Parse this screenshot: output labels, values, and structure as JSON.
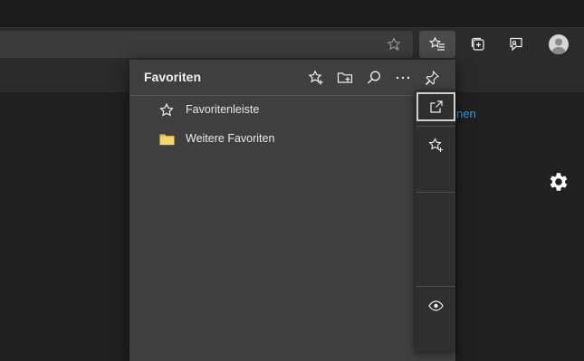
{
  "flyout": {
    "title": "Favoriten",
    "items": [
      {
        "label": "Favoritenleiste",
        "icon": "star-outline-icon"
      },
      {
        "label": "Weitere Favoriten",
        "icon": "folder-icon"
      }
    ]
  },
  "background": {
    "link_fragment": "nen"
  },
  "colors": {
    "accent_link": "#2a9fe8",
    "folder": "#e8c14e",
    "panel": "#3f3f3f"
  }
}
